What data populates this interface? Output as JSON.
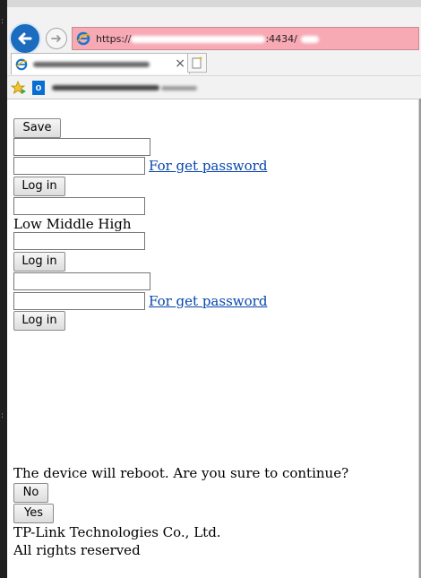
{
  "browser": {
    "back_icon": "back-arrow-icon",
    "forward_icon": "forward-arrow-icon",
    "address": {
      "scheme": "https://",
      "port_path": ":4434/"
    },
    "tab": {
      "close": "×"
    },
    "colors": {
      "back_button": "#1b6cbf",
      "address_bar_error": "#f7a9b4",
      "ie_blue": "#1a77c9"
    }
  },
  "page": {
    "save_label": "Save",
    "login_form_1": {
      "forgot_link": "For get password",
      "login_label": "Log in"
    },
    "strength_meter_label": "Low Middle High",
    "login_form_2": {
      "login_label": "Log in"
    },
    "login_form_3": {
      "forgot_link": "For get password",
      "login_label": "Log in"
    },
    "reboot_prompt": "The device will reboot. Are you sure to continue?",
    "no_label": "No",
    "yes_label": "Yes",
    "footer": {
      "company": "TP-Link Technologies Co., Ltd.",
      "rights": "All rights reserved"
    }
  }
}
